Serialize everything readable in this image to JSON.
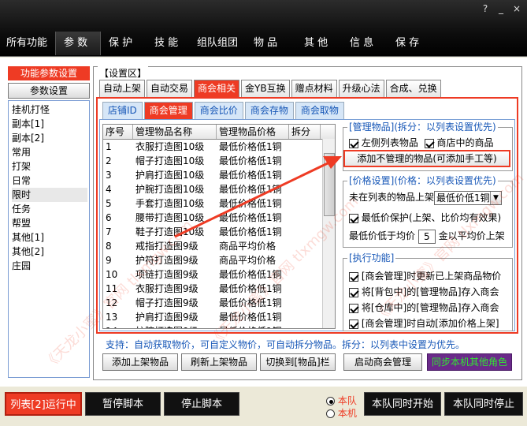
{
  "topnav": {
    "tabs": [
      "所有功能",
      "参 数",
      "保 护",
      "技 能",
      "组队组团",
      "物 品",
      "其 他",
      "信 息",
      "保 存"
    ],
    "controls": [
      "?",
      "_",
      "×"
    ]
  },
  "sidebar": {
    "title": "功能参数设置",
    "button": "参数设置",
    "items": [
      "挂机打怪",
      "副本[1]",
      "副本[2]",
      "常用",
      "打架",
      "日常",
      "限时",
      "任务",
      "帮盟",
      "其他[1]",
      "其他[2]",
      "庄园"
    ]
  },
  "settings": {
    "legend": "【设置区】",
    "tabs": [
      "自动上架",
      "自动交易",
      "商会相关",
      "金YB互换",
      "赠点材料",
      "升级心法",
      "合成、兑换"
    ],
    "subtabs": [
      "店铺ID",
      "商会管理",
      "商会比价",
      "商会存物",
      "商会取物"
    ]
  },
  "table": {
    "headers": [
      "序号",
      "管理物品名称",
      "管理物品价格",
      "拆分"
    ],
    "rows": [
      [
        "1",
        "衣服打造图10级",
        "最低价格低1铜",
        ""
      ],
      [
        "2",
        "帽子打造图10级",
        "最低价格低1铜",
        ""
      ],
      [
        "3",
        "护肩打造图10级",
        "最低价格低1铜",
        ""
      ],
      [
        "4",
        "护腕打造图10级",
        "最低价格低1铜",
        ""
      ],
      [
        "5",
        "手套打造图10级",
        "最低价格低1铜",
        ""
      ],
      [
        "6",
        "腰带打造图10级",
        "最低价格低1铜",
        ""
      ],
      [
        "7",
        "鞋子打造图10级",
        "最低价格低1铜",
        ""
      ],
      [
        "8",
        "戒指打造图9级",
        "商品平均价格",
        ""
      ],
      [
        "9",
        "护符打造图9级",
        "商品平均价格",
        ""
      ],
      [
        "10",
        "项链打造图9级",
        "最低价格低1铜",
        ""
      ],
      [
        "11",
        "衣服打造图9级",
        "最低价格低1铜",
        ""
      ],
      [
        "12",
        "帽子打造图9级",
        "最低价格低1铜",
        ""
      ],
      [
        "13",
        "护肩打造图9级",
        "最低价格低1铜",
        ""
      ],
      [
        "14",
        "护腕打造图9级",
        "最低价格低1铜",
        ""
      ]
    ]
  },
  "manage": {
    "legend": "[管理物品](拆分：以列表设置优先)",
    "cb_list": "左侧列表物品",
    "cb_shop": "商店中的商品",
    "add_button": "添加不管理的物品(可添加手工等)"
  },
  "price": {
    "legend": "[价格设置](价格：以列表设置优先)",
    "unlisted_label": "未在列表的物品上架",
    "unlisted_value": "最低价低1铜",
    "cb_protect": "最低价保护(上架、比价均有效果)",
    "below_avg_pre": "最低价低于均价",
    "below_avg_value": "5",
    "below_avg_post": "金以平均价上架"
  },
  "exec": {
    "legend": "[执行功能]",
    "items": [
      "[商会管理]时更新已上架商品物价",
      "将[背包中]的[管理物品]存入商会",
      "将[仓库中]的[管理物品]存入商会",
      "[商会管理]时自动[添加价格上架]"
    ]
  },
  "support_text": "支持：自动获取物价，可自定义物价，可自动拆分物品。拆分：以列表中设置为优先。",
  "actions": [
    "添加上架物品",
    "刷新上架物品",
    "切换到[物品]栏",
    "启动商会管理",
    "同步本机其他角色"
  ],
  "bottom": {
    "status": "列表[2]运行中",
    "pause": "暂停脚本",
    "stop": "停止脚本",
    "radio_team": "本队",
    "radio_local": "本机",
    "start_all": "本队同时开始",
    "stop_all": "本队同时停止"
  },
  "watermark": "《天龙小蜜》官网 tlxmgw.com",
  "colors": {
    "accent": "#ee3b24",
    "link_blue": "#1757b7",
    "sync_bg": "#6b2a8a",
    "sync_text": "#32e632"
  }
}
